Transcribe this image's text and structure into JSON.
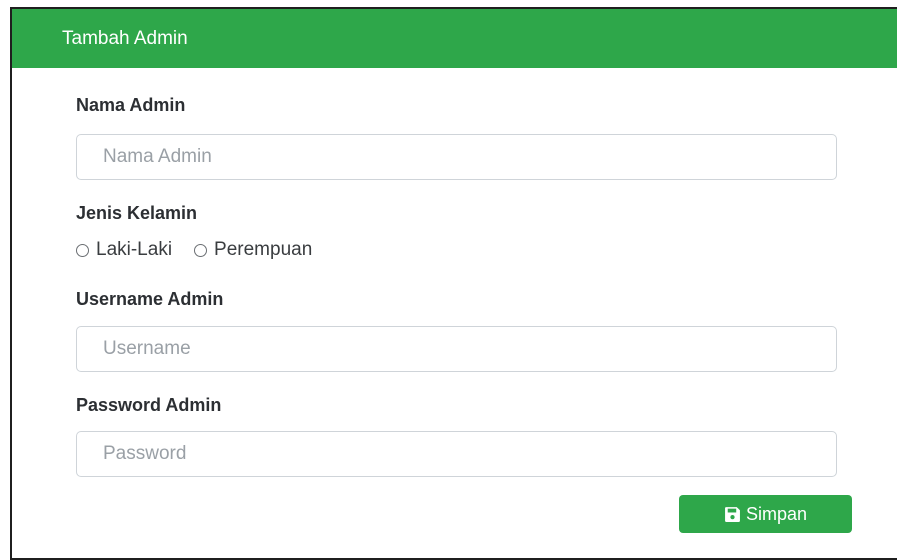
{
  "card": {
    "title": "Tambah Admin"
  },
  "form": {
    "nama": {
      "label": "Nama Admin",
      "placeholder": "Nama Admin",
      "value": ""
    },
    "gender": {
      "label": "Jenis Kelamin",
      "options": [
        "Laki-Laki",
        "Perempuan"
      ],
      "selected": null
    },
    "username": {
      "label": "Username Admin",
      "placeholder": "Username",
      "value": ""
    },
    "password": {
      "label": "Password Admin",
      "placeholder": "Password",
      "value": ""
    },
    "submit": {
      "label": "Simpan",
      "icon": "floppy-disk-icon"
    }
  },
  "colors": {
    "accent": "#2ea74a",
    "header_text": "#ffffff",
    "input_border": "#cfd4d9"
  }
}
